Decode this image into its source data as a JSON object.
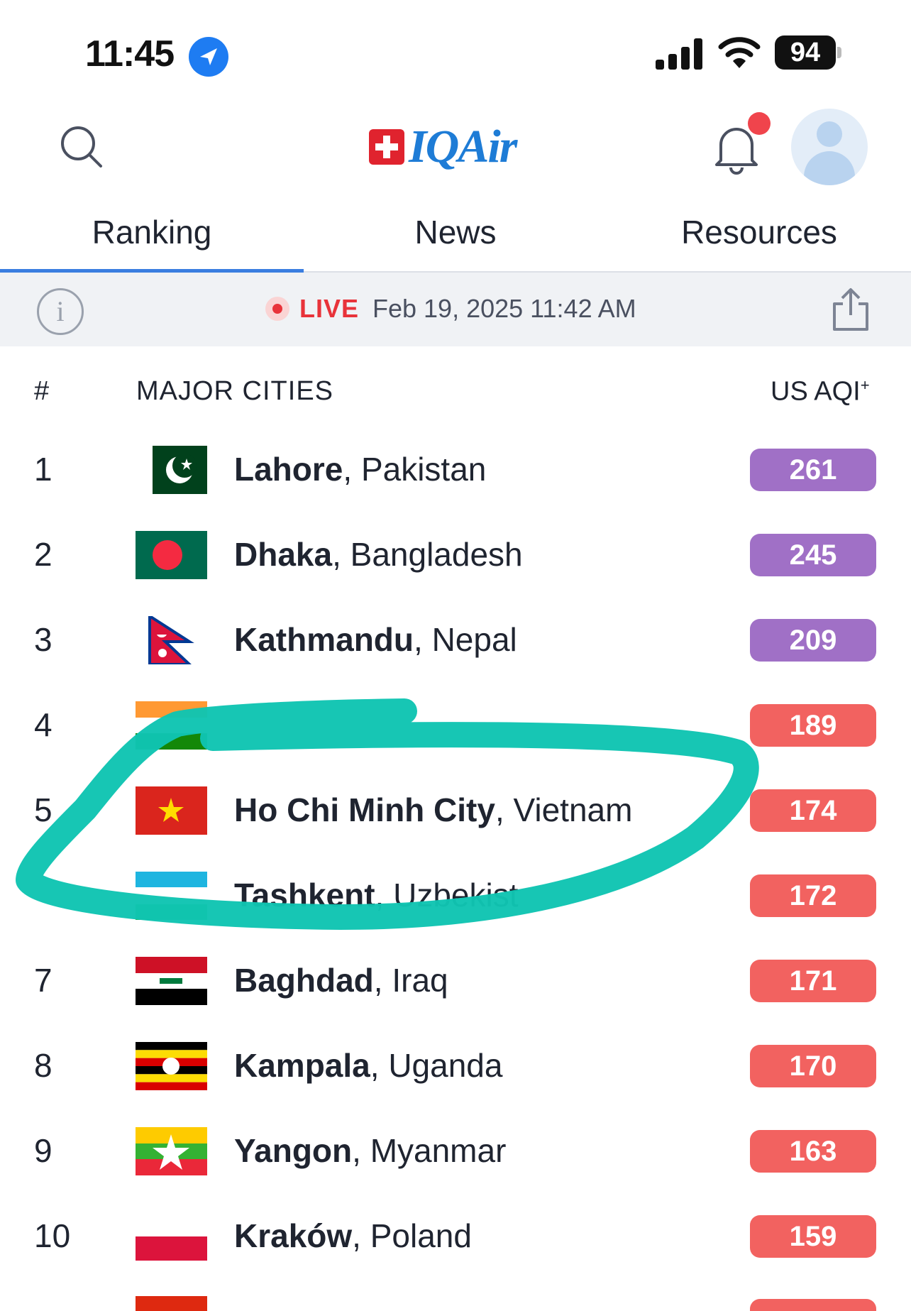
{
  "status_bar": {
    "time": "11:45",
    "battery": "94"
  },
  "header": {
    "logo_text": "IQAir"
  },
  "tabs": [
    {
      "label": "Ranking",
      "active": true
    },
    {
      "label": "News",
      "active": false
    },
    {
      "label": "Resources",
      "active": false
    }
  ],
  "live_bar": {
    "live_label": "LIVE",
    "timestamp": "Feb 19, 2025 11:42 AM"
  },
  "table": {
    "col_rank": "#",
    "col_city": "MAJOR CITIES",
    "col_aqi": "US AQI",
    "col_aqi_sup": "+",
    "rows": [
      {
        "rank": "1",
        "city": "Lahore",
        "country": "Pakistan",
        "aqi": "261",
        "level": "purple"
      },
      {
        "rank": "2",
        "city": "Dhaka",
        "country": "Bangladesh",
        "aqi": "245",
        "level": "purple"
      },
      {
        "rank": "3",
        "city": "Kathmandu",
        "country": "Nepal",
        "aqi": "209",
        "level": "purple"
      },
      {
        "rank": "4",
        "city": "",
        "country": "",
        "aqi": "189",
        "level": "red"
      },
      {
        "rank": "5",
        "city": "Ho Chi Minh City",
        "country": "Vietnam",
        "aqi": "174",
        "level": "red"
      },
      {
        "rank": "",
        "city": "Tashkent",
        "country": "Uzbekist",
        "aqi": "172",
        "level": "red"
      },
      {
        "rank": "7",
        "city": "Baghdad",
        "country": "Iraq",
        "aqi": "171",
        "level": "red"
      },
      {
        "rank": "8",
        "city": "Kampala",
        "country": "Uganda",
        "aqi": "170",
        "level": "red"
      },
      {
        "rank": "9",
        "city": "Yangon",
        "country": "Myanmar",
        "aqi": "163",
        "level": "red"
      },
      {
        "rank": "10",
        "city": "Kraków",
        "country": "Poland",
        "aqi": "159",
        "level": "red"
      }
    ]
  },
  "colors": {
    "accent": "#3a7ee0",
    "live": "#e8333a",
    "aqi_purple": "#a070c6",
    "aqi_red": "#f26260",
    "annotation": "#10c4b2"
  }
}
